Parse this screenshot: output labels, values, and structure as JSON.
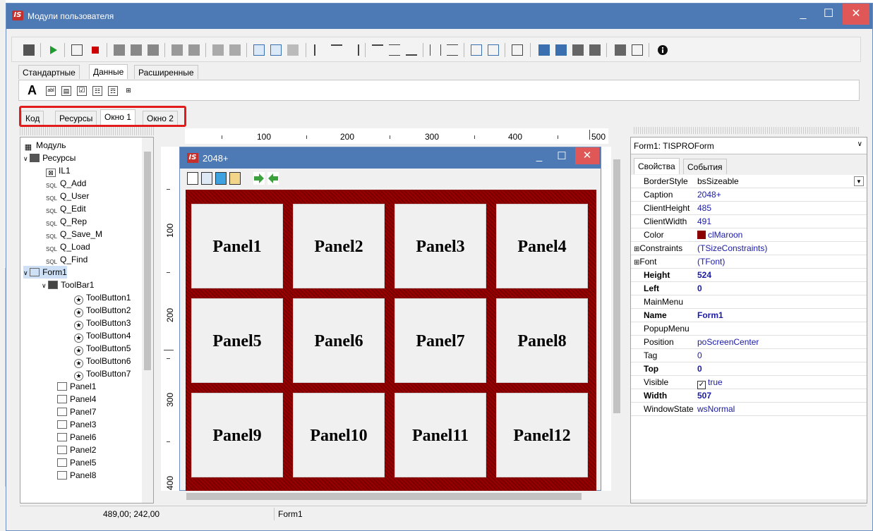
{
  "window": {
    "title": "Модули пользователя",
    "app_icon": "IS",
    "minimize": "_",
    "maximize": "☐",
    "close": "✕"
  },
  "palette_tabs": [
    "Стандартные",
    "Данные",
    "Расширенные"
  ],
  "component_icons": [
    "A",
    "abl",
    "▤",
    "☑",
    "☷",
    "☶",
    "⊞"
  ],
  "editor_tabs": [
    "Код",
    "Ресурсы",
    "Окно 1",
    "Окно 2"
  ],
  "tree": {
    "root": "Модуль",
    "resources_label": "Ресурсы",
    "resources": [
      "IL1",
      "Q_Add",
      "Q_User",
      "Q_Edit",
      "Q_Rep",
      "Q_Save_M",
      "Q_Load",
      "Q_Find"
    ],
    "sql_icon": "SQL",
    "form_label": "Form1",
    "toolbar_label": "ToolBar1",
    "tool_buttons": [
      "ToolButton1",
      "ToolButton2",
      "ToolButton3",
      "ToolButton4",
      "ToolButton5",
      "ToolButton6",
      "ToolButton7"
    ],
    "panels": [
      "Panel1",
      "Panel4",
      "Panel7",
      "Panel3",
      "Panel6",
      "Panel2",
      "Panel5",
      "Panel8"
    ]
  },
  "ruler": {
    "top": [
      "100",
      "200",
      "300",
      "400",
      "500"
    ],
    "left": [
      "100",
      "200",
      "300",
      "400"
    ]
  },
  "form": {
    "title": "2048+",
    "icon": "IS",
    "panels": [
      "Panel1",
      "Panel2",
      "Panel3",
      "Panel4",
      "Panel5",
      "Panel6",
      "Panel7",
      "Panel8",
      "Panel9",
      "Panel10",
      "Panel11",
      "Panel12"
    ],
    "color": "#8b0000"
  },
  "inspector": {
    "object": "Form1: TISPROForm",
    "tabs": [
      "Свойства",
      "События"
    ],
    "properties": [
      {
        "name": "BorderStyle",
        "value": "bsSizeable",
        "bold": false
      },
      {
        "name": "Caption",
        "value": "2048+",
        "bold": false
      },
      {
        "name": "ClientHeight",
        "value": "485",
        "bold": false
      },
      {
        "name": "ClientWidth",
        "value": "491",
        "bold": false
      },
      {
        "name": "Color",
        "value": "clMaroon",
        "bold": false
      },
      {
        "name": "Constraints",
        "value": "(TSizeConstraints)",
        "bold": false
      },
      {
        "name": "Font",
        "value": "(TFont)",
        "bold": false
      },
      {
        "name": "Height",
        "value": "524",
        "bold": true
      },
      {
        "name": "Left",
        "value": "0",
        "bold": true
      },
      {
        "name": "MainMenu",
        "value": "",
        "bold": false
      },
      {
        "name": "Name",
        "value": "Form1",
        "bold": true
      },
      {
        "name": "PopupMenu",
        "value": "",
        "bold": false
      },
      {
        "name": "Position",
        "value": "poScreenCenter",
        "bold": false
      },
      {
        "name": "Tag",
        "value": "0",
        "bold": false
      },
      {
        "name": "Top",
        "value": "0",
        "bold": true
      },
      {
        "name": "Visible",
        "value": "true",
        "bold": false
      },
      {
        "name": "Width",
        "value": "507",
        "bold": true
      },
      {
        "name": "WindowState",
        "value": "wsNormal",
        "bold": false
      }
    ]
  },
  "status": {
    "coords": "489,00; 242,00",
    "object": "Form1"
  }
}
